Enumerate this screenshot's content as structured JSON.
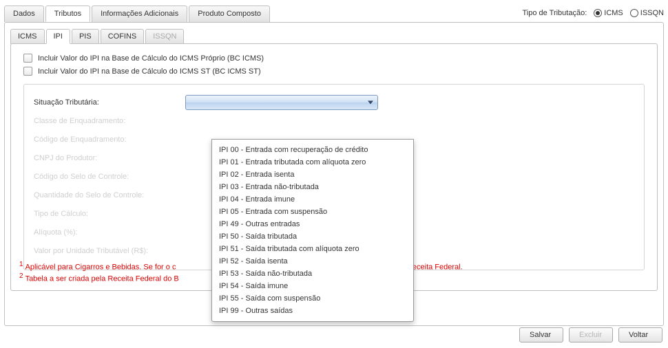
{
  "taxType": {
    "label": "Tipo de Tributação:",
    "options": {
      "icms": "ICMS",
      "issqn": "ISSQN"
    },
    "selected": "icms"
  },
  "topTabs": {
    "dados": "Dados",
    "tributos": "Tributos",
    "infoAdicionais": "Informações Adicionais",
    "produtoComposto": "Produto Composto"
  },
  "innerTabs": {
    "icms": "ICMS",
    "ipi": "IPI",
    "pis": "PIS",
    "cofins": "COFINS",
    "issqn": "ISSQN"
  },
  "checkboxes": {
    "bcIcms": "Incluir Valor do IPI na Base de Cálculo do ICMS Próprio (BC ICMS)",
    "bcIcmsSt": "Incluir Valor do IPI na Base de Cálculo do ICMS ST (BC ICMS ST)"
  },
  "fields": {
    "situacao": "Situação Tributária:",
    "classeEnq": "Classe de Enquadramento:",
    "codigoEnq": "Código de Enquadramento:",
    "cnpjProdutor": "CNPJ do Produtor:",
    "codigoSelo": "Código do Selo de Controle:",
    "qtdSelo": "Quantidade do Selo de Controle:",
    "tipoCalculo": "Tipo de Cálculo:",
    "aliquota": "Alíquota (%):",
    "valorUnidade": "Valor por Unidade Tributável (R$):"
  },
  "dropdown": [
    "IPI 00 - Entrada com recuperação de crédito",
    "IPI 01 - Entrada tributada com alíquota zero",
    "IPI 02 - Entrada isenta",
    "IPI 03 - Entrada não-tributada",
    "IPI 04 - Entrada imune",
    "IPI 05 - Entrada com suspensão",
    "IPI 49 - Outras entradas",
    "IPI 50 - Saída tributada",
    "IPI 51 - Saída tributada com alíquota zero",
    "IPI 52 - Saída isenta",
    "IPI 53 - Saída não-tributada",
    "IPI 54 - Saída imune",
    "IPI 55 - Saída com suspensão",
    "IPI 99 - Outras saídas"
  ],
  "footnotes": {
    "fn1_pre": "Aplicável para Cigarros e Bebidas. Se for o c",
    "fn1_post": "Receita Federal.",
    "fn2": "Tabela a ser criada pela Receita Federal do B"
  },
  "buttons": {
    "salvar": "Salvar",
    "excluir": "Excluir",
    "voltar": "Voltar"
  }
}
